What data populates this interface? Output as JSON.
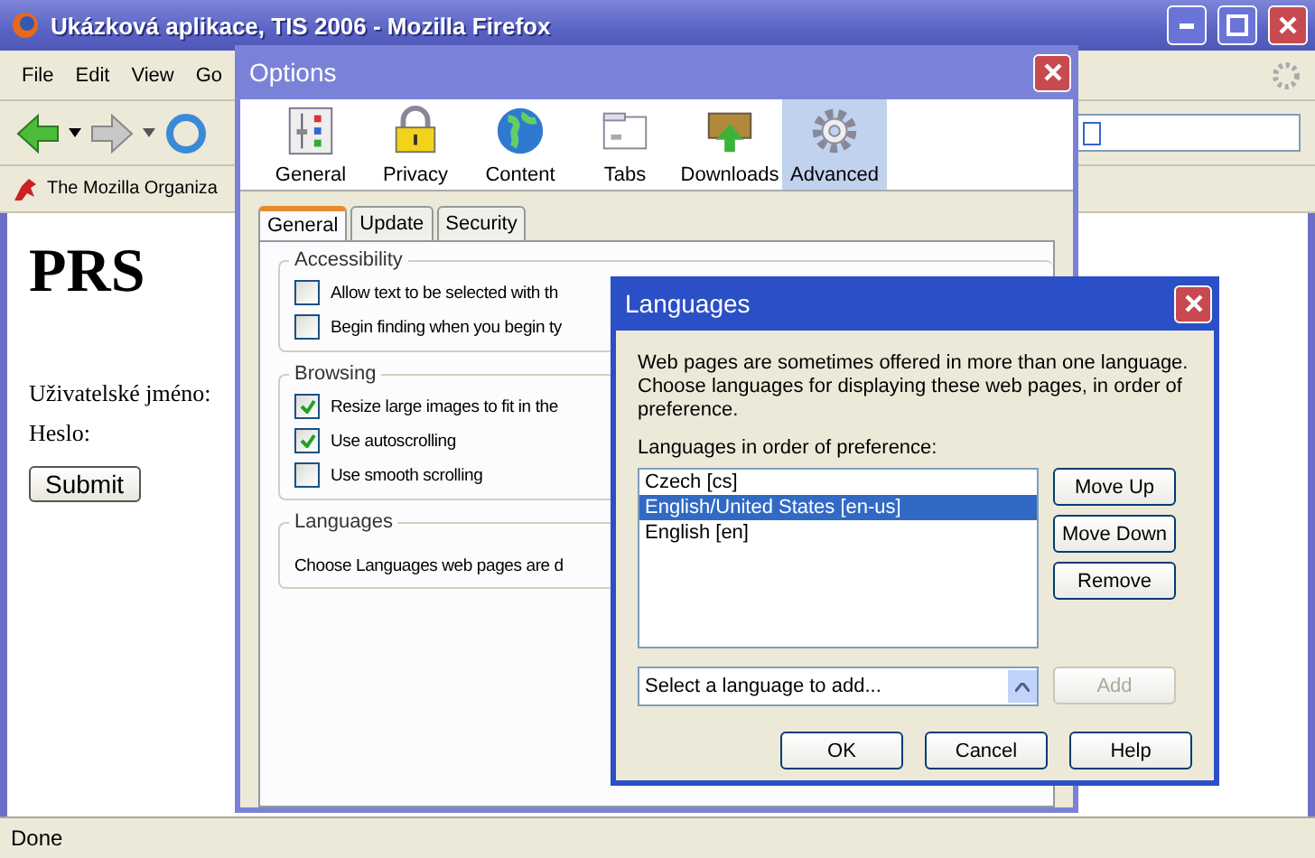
{
  "window": {
    "title": "Ukázková aplikace, TIS 2006 - Mozilla Firefox"
  },
  "menu": [
    "File",
    "Edit",
    "View",
    "Go"
  ],
  "bookmarks": [
    "The Mozilla Organiza"
  ],
  "page": {
    "heading": "PRS",
    "fields": [
      "Uživatelské jméno:",
      "Heslo:"
    ],
    "submit": "Submit"
  },
  "status_bar": "Done",
  "options": {
    "title": "Options",
    "panes": [
      {
        "label": "General",
        "kind": "general",
        "selected": false
      },
      {
        "label": "Privacy",
        "kind": "privacy",
        "selected": false
      },
      {
        "label": "Content",
        "kind": "content",
        "selected": false
      },
      {
        "label": "Tabs",
        "kind": "tabs",
        "selected": false
      },
      {
        "label": "Downloads",
        "kind": "downloads",
        "selected": false
      },
      {
        "label": "Advanced",
        "kind": "advanced",
        "selected": true
      }
    ],
    "tabs": [
      {
        "label": "General",
        "selected": true
      },
      {
        "label": "Update",
        "selected": false
      },
      {
        "label": "Security",
        "selected": false
      }
    ],
    "groups": [
      {
        "legend": "Accessibility",
        "items": [
          {
            "kind": "checkbox",
            "label": "Allow text to be selected with th",
            "checked": false
          },
          {
            "kind": "checkbox",
            "label": "Begin finding when you begin ty",
            "checked": false
          }
        ]
      },
      {
        "legend": "Browsing",
        "items": [
          {
            "kind": "checkbox",
            "label": "Resize large images to fit in the",
            "checked": true
          },
          {
            "kind": "checkbox",
            "label": "Use autoscrolling",
            "checked": true
          },
          {
            "kind": "checkbox",
            "label": "Use smooth scrolling",
            "checked": false
          }
        ]
      },
      {
        "legend": "Languages",
        "items": [
          {
            "kind": "text",
            "label": "Choose Languages web pages are d"
          }
        ]
      }
    ]
  },
  "languages": {
    "title": "Languages",
    "description": "Web pages are sometimes offered in more than one language. Choose languages for displaying these web pages, in order of preference.",
    "list_label": "Languages in order of preference:",
    "list": [
      {
        "label": "Czech  [cs]",
        "selected": false
      },
      {
        "label": "English/United States  [en-us]",
        "selected": true
      },
      {
        "label": "English  [en]",
        "selected": false
      }
    ],
    "side_buttons": [
      "Move Up",
      "Move Down",
      "Remove"
    ],
    "select": {
      "value": "Select a language to add..."
    },
    "add": {
      "label": "Add",
      "disabled": true
    },
    "buttons": [
      "OK",
      "Cancel",
      "Help"
    ]
  }
}
